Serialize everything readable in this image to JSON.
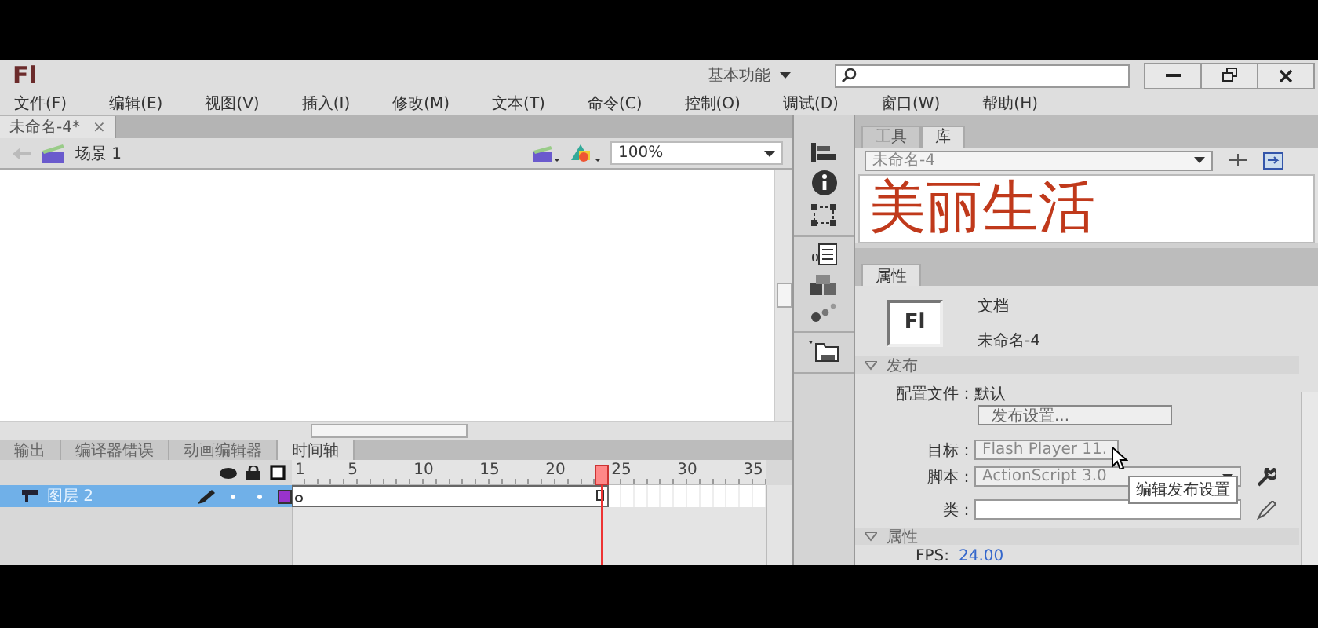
{
  "titlebar": {
    "logo": "Fl",
    "workspace": "基本功能"
  },
  "menu": [
    "文件(F)",
    "编辑(E)",
    "视图(V)",
    "插入(I)",
    "修改(M)",
    "文本(T)",
    "命令(C)",
    "控制(O)",
    "调试(D)",
    "窗口(W)",
    "帮助(H)"
  ],
  "document_tabs": [
    {
      "label": "未命名-4*",
      "close": "×",
      "selected": true
    }
  ],
  "scene": {
    "label": "场景 1",
    "zoom": "100%"
  },
  "panel_tabs": [
    {
      "label": "输出",
      "selected": false
    },
    {
      "label": "编译器错误",
      "selected": false
    },
    {
      "label": "动画编辑器",
      "selected": false
    },
    {
      "label": "时间轴",
      "selected": true
    }
  ],
  "timeline": {
    "frame_numbers": [
      "1",
      "5",
      "10",
      "15",
      "20",
      "25",
      "30",
      "35"
    ],
    "layers": [
      {
        "name": "图层 2",
        "selected": true,
        "color": "#9933cc"
      }
    ]
  },
  "library": {
    "tabs": [
      {
        "label": "工具",
        "selected": false
      },
      {
        "label": "库",
        "selected": true
      }
    ],
    "document": "未命名-4",
    "preview_text": "美丽生活"
  },
  "properties": {
    "tab": "属性",
    "doc_icon": "Fl",
    "type": "文档",
    "name": "未命名-4",
    "publish": {
      "title": "发布",
      "expanded": true,
      "profile_label": "配置文件：",
      "profile": "默认",
      "button": "发布设置...",
      "tooltip": "编辑发布设置",
      "target_label": "目标：",
      "target": "Flash Player 11.",
      "script_label": "脚本：",
      "script": "ActionScript 3.0",
      "class_label": "类："
    },
    "attributes": {
      "title": "属性",
      "expanded": true,
      "fps_label": "FPS:",
      "fps": "24.00"
    }
  }
}
